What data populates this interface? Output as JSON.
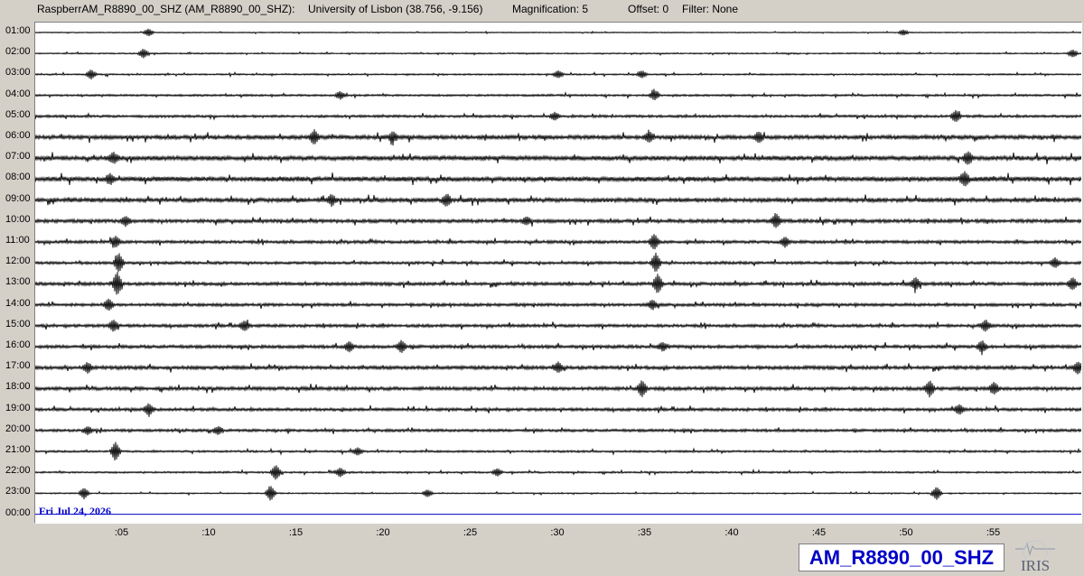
{
  "header": {
    "station": "RaspberrAM_R8890_00_SHZ (AM_R8890_00_SHZ):",
    "location": "University of Lisbon (38.756, -9.156)",
    "magnification": "Magnification: 5",
    "offset": "Offset: 0",
    "filter": "Filter: None"
  },
  "date_label": "Fri Jul 24, 2026",
  "channel_label": "AM_R8890_00_SHZ",
  "logo_text": "IRIS",
  "colors": {
    "trace": "#000000",
    "current_line": "#0000c8",
    "accent_text": "#0000c8",
    "background": "#d4d0c8",
    "plot_bg": "#ffffff"
  },
  "chart_data": {
    "type": "line",
    "subtype": "helicorder",
    "hour_labels": [
      "01:00",
      "02:00",
      "03:00",
      "04:00",
      "05:00",
      "06:00",
      "07:00",
      "08:00",
      "09:00",
      "10:00",
      "11:00",
      "12:00",
      "13:00",
      "14:00",
      "15:00",
      "16:00",
      "17:00",
      "18:00",
      "19:00",
      "20:00",
      "21:00",
      "22:00",
      "23:00",
      "00:00"
    ],
    "minute_ticks": [
      ":05",
      ":10",
      ":15",
      ":20",
      ":25",
      ":30",
      ":35",
      ":40",
      ":45",
      ":50",
      ":55"
    ],
    "minute_tick_values": [
      5,
      10,
      15,
      20,
      25,
      30,
      35,
      40,
      45,
      50,
      55
    ],
    "xlim": [
      0,
      60
    ],
    "line_noise_level": [
      0.4,
      0.5,
      0.6,
      0.8,
      1.0,
      1.6,
      1.8,
      1.9,
      1.7,
      1.4,
      1.2,
      1.1,
      1.3,
      1.2,
      1.2,
      1.3,
      1.4,
      1.4,
      1.2,
      1.1,
      0.8,
      0.7,
      0.5,
      0.0
    ],
    "events": [
      {
        "line": 0,
        "minute": 6.5,
        "amp": 4
      },
      {
        "line": 0,
        "minute": 49.8,
        "amp": 3
      },
      {
        "line": 1,
        "minute": 6.2,
        "amp": 5
      },
      {
        "line": 1,
        "minute": 59.5,
        "amp": 4
      },
      {
        "line": 2,
        "minute": 3.2,
        "amp": 5
      },
      {
        "line": 2,
        "minute": 30.0,
        "amp": 4
      },
      {
        "line": 2,
        "minute": 34.8,
        "amp": 4
      },
      {
        "line": 3,
        "minute": 17.5,
        "amp": 4
      },
      {
        "line": 3,
        "minute": 35.5,
        "amp": 5
      },
      {
        "line": 4,
        "minute": 52.8,
        "amp": 6
      },
      {
        "line": 4,
        "minute": 29.8,
        "amp": 4
      },
      {
        "line": 5,
        "minute": 16.0,
        "amp": 7
      },
      {
        "line": 5,
        "minute": 20.5,
        "amp": 5
      },
      {
        "line": 5,
        "minute": 35.2,
        "amp": 5
      },
      {
        "line": 5,
        "minute": 41.5,
        "amp": 5
      },
      {
        "line": 6,
        "minute": 4.5,
        "amp": 5
      },
      {
        "line": 6,
        "minute": 53.5,
        "amp": 6
      },
      {
        "line": 7,
        "minute": 4.3,
        "amp": 5
      },
      {
        "line": 7,
        "minute": 53.3,
        "amp": 7
      },
      {
        "line": 8,
        "minute": 17.0,
        "amp": 5
      },
      {
        "line": 8,
        "minute": 23.6,
        "amp": 6
      },
      {
        "line": 9,
        "minute": 5.2,
        "amp": 5
      },
      {
        "line": 9,
        "minute": 42.5,
        "amp": 7
      },
      {
        "line": 9,
        "minute": 28.2,
        "amp": 4
      },
      {
        "line": 10,
        "minute": 4.6,
        "amp": 6
      },
      {
        "line": 10,
        "minute": 35.5,
        "amp": 8
      },
      {
        "line": 10,
        "minute": 43.0,
        "amp": 5
      },
      {
        "line": 11,
        "minute": 4.8,
        "amp": 10
      },
      {
        "line": 11,
        "minute": 35.6,
        "amp": 10
      },
      {
        "line": 11,
        "minute": 58.5,
        "amp": 5
      },
      {
        "line": 12,
        "minute": 4.7,
        "amp": 12
      },
      {
        "line": 12,
        "minute": 35.7,
        "amp": 10
      },
      {
        "line": 12,
        "minute": 50.5,
        "amp": 6
      },
      {
        "line": 12,
        "minute": 59.5,
        "amp": 6
      },
      {
        "line": 13,
        "minute": 4.2,
        "amp": 6
      },
      {
        "line": 13,
        "minute": 35.4,
        "amp": 5
      },
      {
        "line": 14,
        "minute": 4.5,
        "amp": 6
      },
      {
        "line": 14,
        "minute": 12.0,
        "amp": 5
      },
      {
        "line": 14,
        "minute": 54.5,
        "amp": 6
      },
      {
        "line": 15,
        "minute": 18.0,
        "amp": 5
      },
      {
        "line": 15,
        "minute": 21.0,
        "amp": 6
      },
      {
        "line": 15,
        "minute": 54.3,
        "amp": 6
      },
      {
        "line": 15,
        "minute": 36.0,
        "amp": 4
      },
      {
        "line": 16,
        "minute": 3.0,
        "amp": 5
      },
      {
        "line": 16,
        "minute": 30.0,
        "amp": 5
      },
      {
        "line": 16,
        "minute": 59.8,
        "amp": 6
      },
      {
        "line": 17,
        "minute": 34.8,
        "amp": 8
      },
      {
        "line": 17,
        "minute": 51.3,
        "amp": 8
      },
      {
        "line": 17,
        "minute": 55.0,
        "amp": 6
      },
      {
        "line": 18,
        "minute": 6.5,
        "amp": 6
      },
      {
        "line": 18,
        "minute": 53.0,
        "amp": 5
      },
      {
        "line": 19,
        "minute": 3.0,
        "amp": 4
      },
      {
        "line": 19,
        "minute": 10.5,
        "amp": 4
      },
      {
        "line": 20,
        "minute": 4.6,
        "amp": 10
      },
      {
        "line": 20,
        "minute": 18.5,
        "amp": 4
      },
      {
        "line": 21,
        "minute": 13.8,
        "amp": 8
      },
      {
        "line": 21,
        "minute": 17.5,
        "amp": 5
      },
      {
        "line": 21,
        "minute": 26.5,
        "amp": 4
      },
      {
        "line": 22,
        "minute": 2.8,
        "amp": 6
      },
      {
        "line": 22,
        "minute": 13.5,
        "amp": 8
      },
      {
        "line": 22,
        "minute": 51.7,
        "amp": 7
      },
      {
        "line": 22,
        "minute": 22.5,
        "amp": 4
      }
    ]
  }
}
